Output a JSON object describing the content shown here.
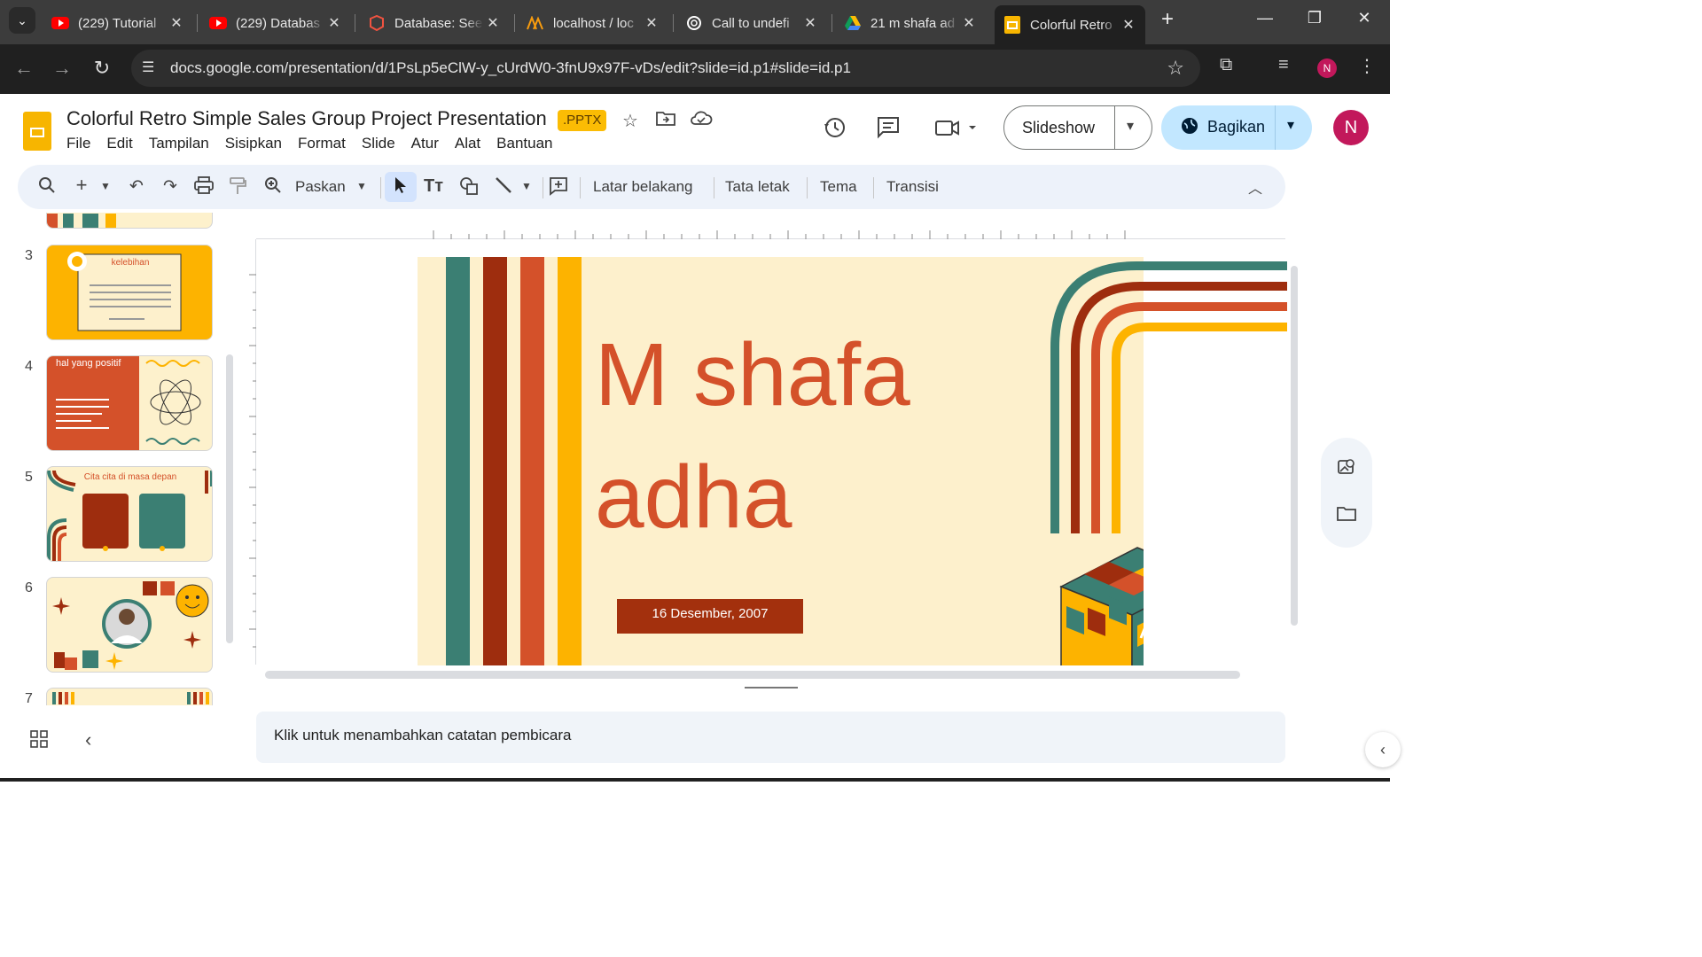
{
  "browser": {
    "tabs": [
      {
        "title": "(229) Tutorial",
        "icon": "youtube-icon"
      },
      {
        "title": "(229) Databas",
        "icon": "youtube-icon"
      },
      {
        "title": "Database: See",
        "icon": "laravel-icon"
      },
      {
        "title": "localhost / loc",
        "icon": "phpmyadmin-icon"
      },
      {
        "title": "Call to undefi",
        "icon": "openai-icon"
      },
      {
        "title": "21 m shafa ad",
        "icon": "drive-icon"
      },
      {
        "title": "Colorful Retro",
        "icon": "slides-icon",
        "active": true
      }
    ],
    "url": "docs.google.com/presentation/d/1PsLp5eClW-y_cUrdW0-3fnU9x97F-vDs/edit?slide=id.p1#slide=id.p1",
    "profile_initial": "N"
  },
  "doc": {
    "title": "Colorful Retro Simple Sales Group Project Presentation",
    "badge": ".PPTX",
    "menu": [
      "File",
      "Edit",
      "Tampilan",
      "Sisipkan",
      "Format",
      "Slide",
      "Atur",
      "Alat",
      "Bantuan"
    ]
  },
  "header": {
    "slideshow_label": "Slideshow",
    "share_label": "Bagikan",
    "avatar_initial": "N"
  },
  "toolbar": {
    "zoom_label": "Paskan",
    "background_label": "Latar belakang",
    "layout_label": "Tata letak",
    "theme_label": "Tema",
    "transition_label": "Transisi"
  },
  "filmstrip": {
    "slides": [
      {
        "number": "3",
        "title": "kelebihan"
      },
      {
        "number": "4",
        "title": "hal yang positif"
      },
      {
        "number": "5",
        "title": "Cita cita di masa depan"
      },
      {
        "number": "6",
        "title": ""
      },
      {
        "number": "7",
        "title": ""
      }
    ]
  },
  "slide": {
    "name_line1": "M shafa",
    "name_line2": "adha",
    "date": "16 Desember, 2007",
    "colors": {
      "background": "#fdf0cc",
      "teal": "#3b7f73",
      "maroon": "#9e2d0e",
      "orange": "#d4512a",
      "yellow": "#fdb300"
    }
  },
  "notes": {
    "placeholder": "Klik untuk menambahkan catatan pembicara"
  }
}
